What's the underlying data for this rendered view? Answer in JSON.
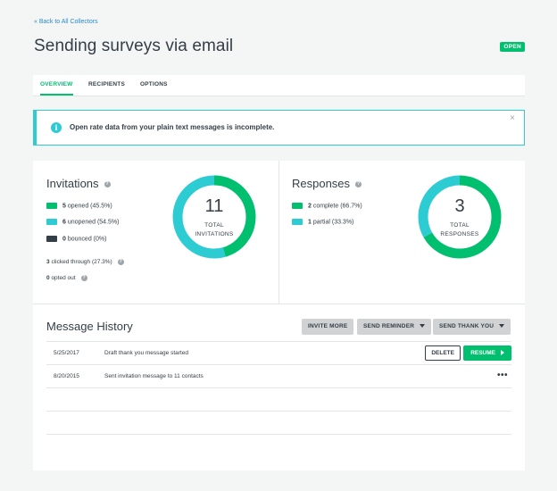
{
  "nav": {
    "back_label": "« Back to All Collectors"
  },
  "header": {
    "title": "Sending surveys via email",
    "status": "OPEN"
  },
  "tabs": [
    {
      "label": "OVERVIEW",
      "active": true
    },
    {
      "label": "RECIPIENTS",
      "active": false
    },
    {
      "label": "OPTIONS",
      "active": false
    }
  ],
  "alert": {
    "message": "Open rate data from your plain text messages is incomplete.",
    "close": "×",
    "icon": "info-icon"
  },
  "invitations": {
    "title": "Invitations",
    "legend": [
      {
        "count": "5",
        "text": "opened (45.5%)",
        "color": "#00bf6f"
      },
      {
        "count": "6",
        "text": "unopened (54.5%)",
        "color": "#2dccd3"
      },
      {
        "count": "0",
        "text": "bounced (0%)",
        "color": "#333e48"
      }
    ],
    "clicked_count": "3",
    "clicked_text": "clicked through (27.3%)",
    "opted_count": "0",
    "opted_text": "opted out",
    "donut": {
      "total": "11",
      "label_line1": "TOTAL",
      "label_line2": "INVITATIONS",
      "fractions": [
        0.455,
        0.545
      ]
    }
  },
  "responses": {
    "title": "Responses",
    "legend": [
      {
        "count": "2",
        "text": "complete (66.7%)",
        "color": "#00bf6f"
      },
      {
        "count": "1",
        "text": "partial (33.3%)",
        "color": "#2dccd3"
      }
    ],
    "donut": {
      "total": "3",
      "label_line1": "TOTAL",
      "label_line2": "RESPONSES",
      "fractions": [
        0.667,
        0.333
      ]
    }
  },
  "history": {
    "title": "Message History",
    "buttons": {
      "invite_more": "INVITE MORE",
      "send_reminder": "SEND REMINDER",
      "send_thank_you": "SEND THANK YOU"
    },
    "rows": [
      {
        "date": "5/25/2017",
        "message": "Draft thank you message started",
        "delete": "DELETE",
        "resume": "RESUME"
      },
      {
        "date": "8/20/2015",
        "message": "Sent invitation message to 11 contacts",
        "more": "•••"
      }
    ]
  },
  "help_icon": "?"
}
